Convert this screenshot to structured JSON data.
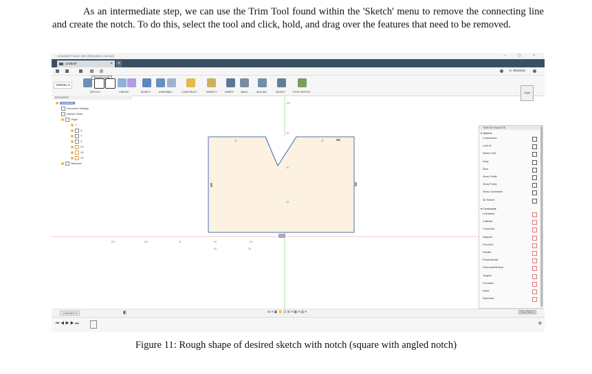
{
  "paragraph": "As an intermediate step, we can use the Trim Tool found within the 'Sketch' menu to remove the connecting line and create the notch. To do this, select the tool and click, hold, and drag over the features that need to be removed.",
  "caption": "Figure 11: Rough shape of desired sketch with notch (square with angled notch)",
  "app": {
    "title": "Autodesk Fusion 360 (Education License)",
    "tab_label": "Untitled*",
    "tooltip": "Stopping mode",
    "workspace": "MODEL",
    "account": "K. Bhatnam",
    "menus": [
      "SKETCH",
      "CREATE",
      "MODIFY",
      "ASSEMBLE",
      "CONSTRUCT",
      "INSPECT",
      "INSERT",
      "MAKE",
      "ADD-INS",
      "SELECT",
      "STOP SKETCH"
    ],
    "viewcube": "TOP"
  },
  "browser": {
    "header": "BROWSER",
    "root": "(Unsaved)",
    "items": [
      "Document Settings",
      "Named Views",
      "Origin",
      "O",
      "X",
      "Y",
      "Z",
      "XY",
      "XZ",
      "YZ",
      "Sketches"
    ]
  },
  "canvas_labels": {
    "dims": [
      "25",
      "50",
      "25",
      "25",
      "50",
      "125",
      "100",
      "75",
      "50",
      "25",
      "100"
    ]
  },
  "palette": {
    "header": "SKETCH PALETTE",
    "options_title": "Options",
    "options": [
      "Construction",
      "Look At",
      "Sketch Grid",
      "Snap",
      "Slice",
      "Show Profile",
      "Show Points",
      "Show Constraints",
      "3D Sketch"
    ],
    "constraints_title": "Constraints",
    "constraints": [
      "Coincident",
      "Collinear",
      "Concentric",
      "Midpoint",
      "Fix/UnFix",
      "Parallel",
      "Perpendicular",
      "Horizontal/Vertical",
      "Tangent",
      "Curvature",
      "Equal",
      "Symmetry"
    ],
    "stop_button": "Stop Sketch"
  },
  "status": {
    "comments": "COMMENTS"
  },
  "colors": {
    "accent": "#3b4f63",
    "sketch_fill": "#fdf2e2",
    "sketch_line": "#4a6fb0"
  }
}
